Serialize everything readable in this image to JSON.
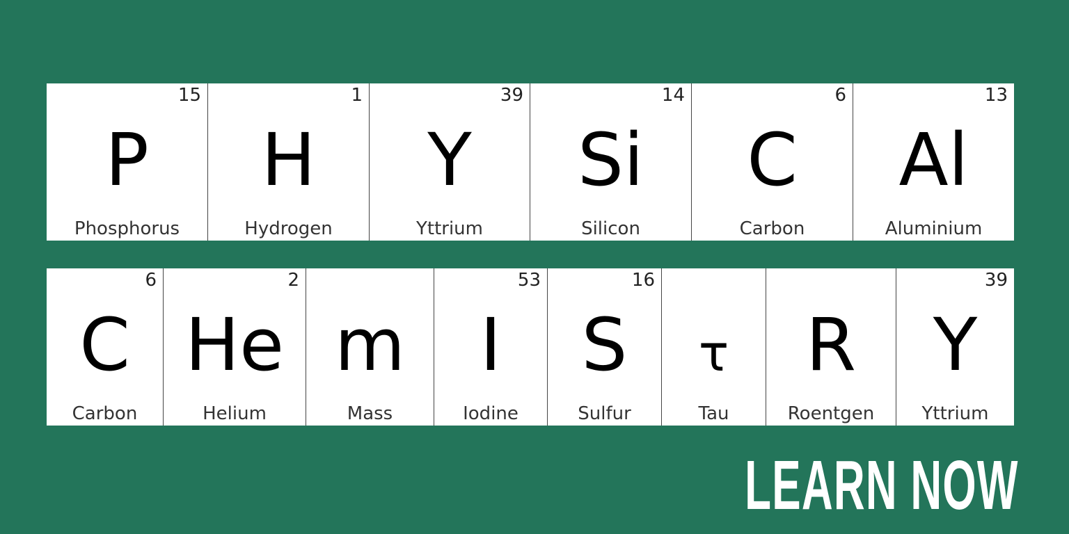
{
  "background_color": "#23755A",
  "rows": [
    {
      "word": "PHYSICAL",
      "tiles": [
        {
          "number": "15",
          "symbol": "P",
          "name": "Phosphorus"
        },
        {
          "number": "1",
          "symbol": "H",
          "name": "Hydrogen"
        },
        {
          "number": "39",
          "symbol": "Y",
          "name": "Yttrium"
        },
        {
          "number": "14",
          "symbol": "Si",
          "name": "Silicon"
        },
        {
          "number": "6",
          "symbol": "C",
          "name": "Carbon"
        },
        {
          "number": "13",
          "symbol": "Al",
          "name": "Aluminium"
        }
      ]
    },
    {
      "word": "CHEMISTRY",
      "tiles": [
        {
          "number": "6",
          "symbol": "C",
          "name": "Carbon"
        },
        {
          "number": "2",
          "symbol": "He",
          "name": "Helium"
        },
        {
          "number": "",
          "symbol": "m",
          "name": "Mass"
        },
        {
          "number": "53",
          "symbol": "I",
          "name": "Iodine"
        },
        {
          "number": "16",
          "symbol": "S",
          "name": "Sulfur"
        },
        {
          "number": "",
          "symbol": "τ",
          "name": "Tau"
        },
        {
          "number": "",
          "symbol": "R",
          "name": "Roentgen"
        },
        {
          "number": "39",
          "symbol": "Y",
          "name": "Yttrium"
        }
      ]
    }
  ],
  "cta": {
    "label": "LEARN NOW"
  }
}
